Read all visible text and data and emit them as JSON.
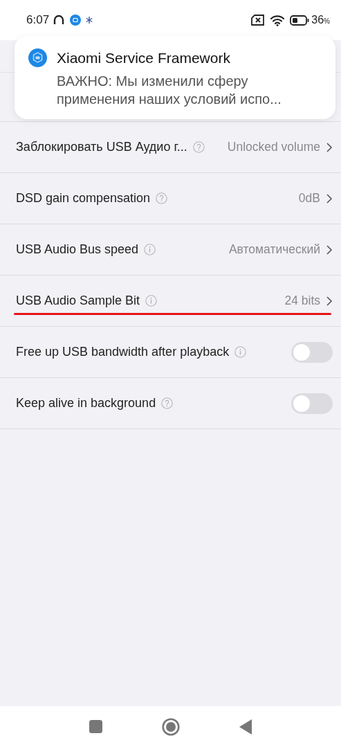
{
  "status_bar": {
    "time": "6:07",
    "battery_level": "36",
    "battery_unit": "%"
  },
  "notification": {
    "app": "Xiaomi Service Framework",
    "message": "ВАЖНО: Мы изменили сферу применения наших условий испо..."
  },
  "settings": [
    {
      "kind": "value",
      "label": "Заблокировать USB Аудио г...",
      "help": {
        "kind": "question"
      },
      "value": "Unlocked volume",
      "highlighted": false
    },
    {
      "kind": "value",
      "label": "DSD gain compensation",
      "help": {
        "kind": "question"
      },
      "value": "0dB",
      "highlighted": false
    },
    {
      "kind": "value",
      "label": "USB Audio Bus speed",
      "help": {
        "kind": "info"
      },
      "value": "Автоматический",
      "highlighted": false
    },
    {
      "kind": "value",
      "label": "USB Audio Sample Bit",
      "help": {
        "kind": "info"
      },
      "value": "24 bits",
      "highlighted": true
    },
    {
      "kind": "toggle",
      "label": "Free up USB bandwidth after playback",
      "help": {
        "kind": "info"
      },
      "on": false,
      "highlighted": false
    },
    {
      "kind": "toggle",
      "label": "Keep alive in background",
      "help": {
        "kind": "question"
      },
      "on": false,
      "highlighted": false
    }
  ]
}
